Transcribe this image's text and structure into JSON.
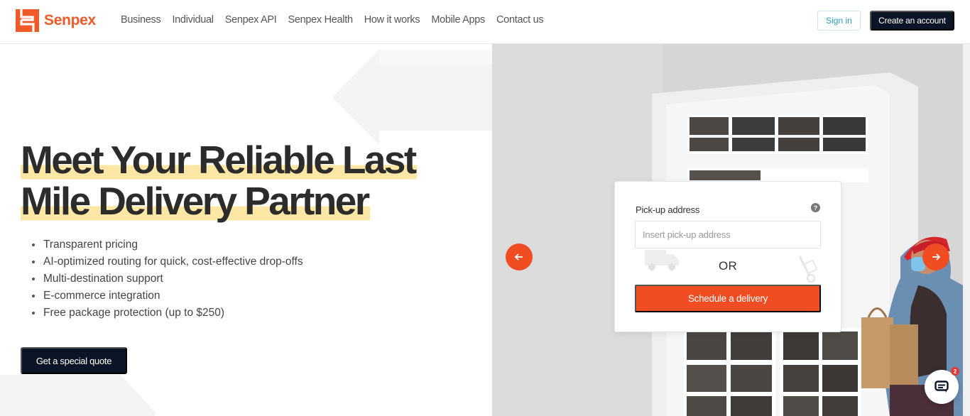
{
  "brand": {
    "name": "Senpex",
    "accent": "#f05a28",
    "dark": "#0c1526",
    "highlight": "#fde7a4"
  },
  "nav": {
    "links": [
      "Business",
      "Individual",
      "Senpex API",
      "Senpex Health",
      "How it works",
      "Mobile Apps",
      "Contact us"
    ],
    "signin_label": "Sign in",
    "create_label": "Create an account"
  },
  "hero": {
    "headline_line1": "Meet Your Reliable Last",
    "headline_line2": "Mile Delivery Partner",
    "features": [
      "Transparent pricing",
      "AI-optimized routing for quick, cost-effective drop-offs",
      "Multi-destination support",
      "E-commerce integration",
      "Free package protection (up to $250)"
    ],
    "quote_label": "Get a special quote"
  },
  "carousel": {
    "prev_icon": "arrow-left-icon",
    "next_icon": "arrow-right-icon"
  },
  "form": {
    "label": "Pick-up address",
    "help_glyph": "?",
    "input_placeholder": "Insert pick-up address",
    "input_value": "",
    "or_text": "OR",
    "schedule_label": "Schedule a delivery"
  },
  "chat": {
    "badge_count": "2",
    "icon": "chat-icon"
  }
}
